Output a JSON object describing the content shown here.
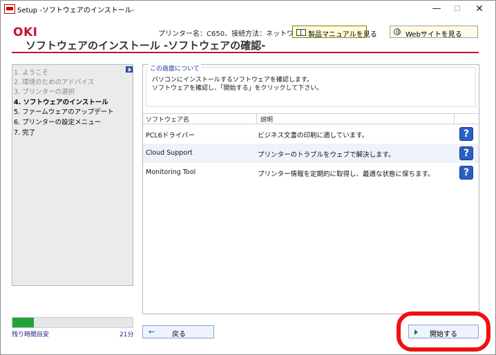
{
  "window": {
    "title": "Setup -ソフトウェアのインストール-",
    "minimize": "—",
    "maximize": "☐",
    "close": "✕"
  },
  "header": {
    "logo": "OKI",
    "printer_info": "プリンター名：C650、接続方法：ネットワーク",
    "manual_button": "製品マニュアルを見る",
    "website_button": "Webサイトを見る",
    "page_title": "ソフトウェアのインストール -ソフトウェアの確認-"
  },
  "steps": [
    {
      "label": "1. ようこそ",
      "state": "done"
    },
    {
      "label": "2. 環境のためのアドバイス",
      "state": "done"
    },
    {
      "label": "3. プリンターの選択",
      "state": "done"
    },
    {
      "label": "4. ソフトウェアのインストール",
      "state": "current"
    },
    {
      "label": "5. ファームウェアのアップデート",
      "state": "future"
    },
    {
      "label": "6. プリンターの設定メニュー",
      "state": "future"
    },
    {
      "label": "7. 完了",
      "state": "future"
    }
  ],
  "progress": {
    "fraction": 0.18,
    "remaining_label": "残り時間目安",
    "remaining_value": "21分",
    "color": "#23a33c"
  },
  "about": {
    "legend": "この画面について",
    "lines": [
      "パソコンにインストールするソフトウェアを確認します。",
      "ソフトウェアを確認し、「開始する」をクリックして下さい。"
    ]
  },
  "software_table": {
    "headers": {
      "name": "ソフトウェア名",
      "description": "説明"
    },
    "rows": [
      {
        "name": "PCL6ドライバー",
        "description": "ビジネス文書の印刷に適しています。",
        "icon": "help-icon"
      },
      {
        "name": "Cloud Support",
        "description": "プリンターのトラブルをウェブで解決します。",
        "icon": "help-icon"
      },
      {
        "name": "Monitoring Tool",
        "description": "プリンター情報を定期的に取得し、最適な状態に保ちます。",
        "icon": "help-icon"
      }
    ]
  },
  "buttons": {
    "back": "戻る",
    "start": "開始する",
    "help_glyph": "?",
    "back_glyph": "←"
  },
  "colors": {
    "brand": "#c8102e",
    "highlight": "#ee1111",
    "help": "#2a5fc4"
  }
}
